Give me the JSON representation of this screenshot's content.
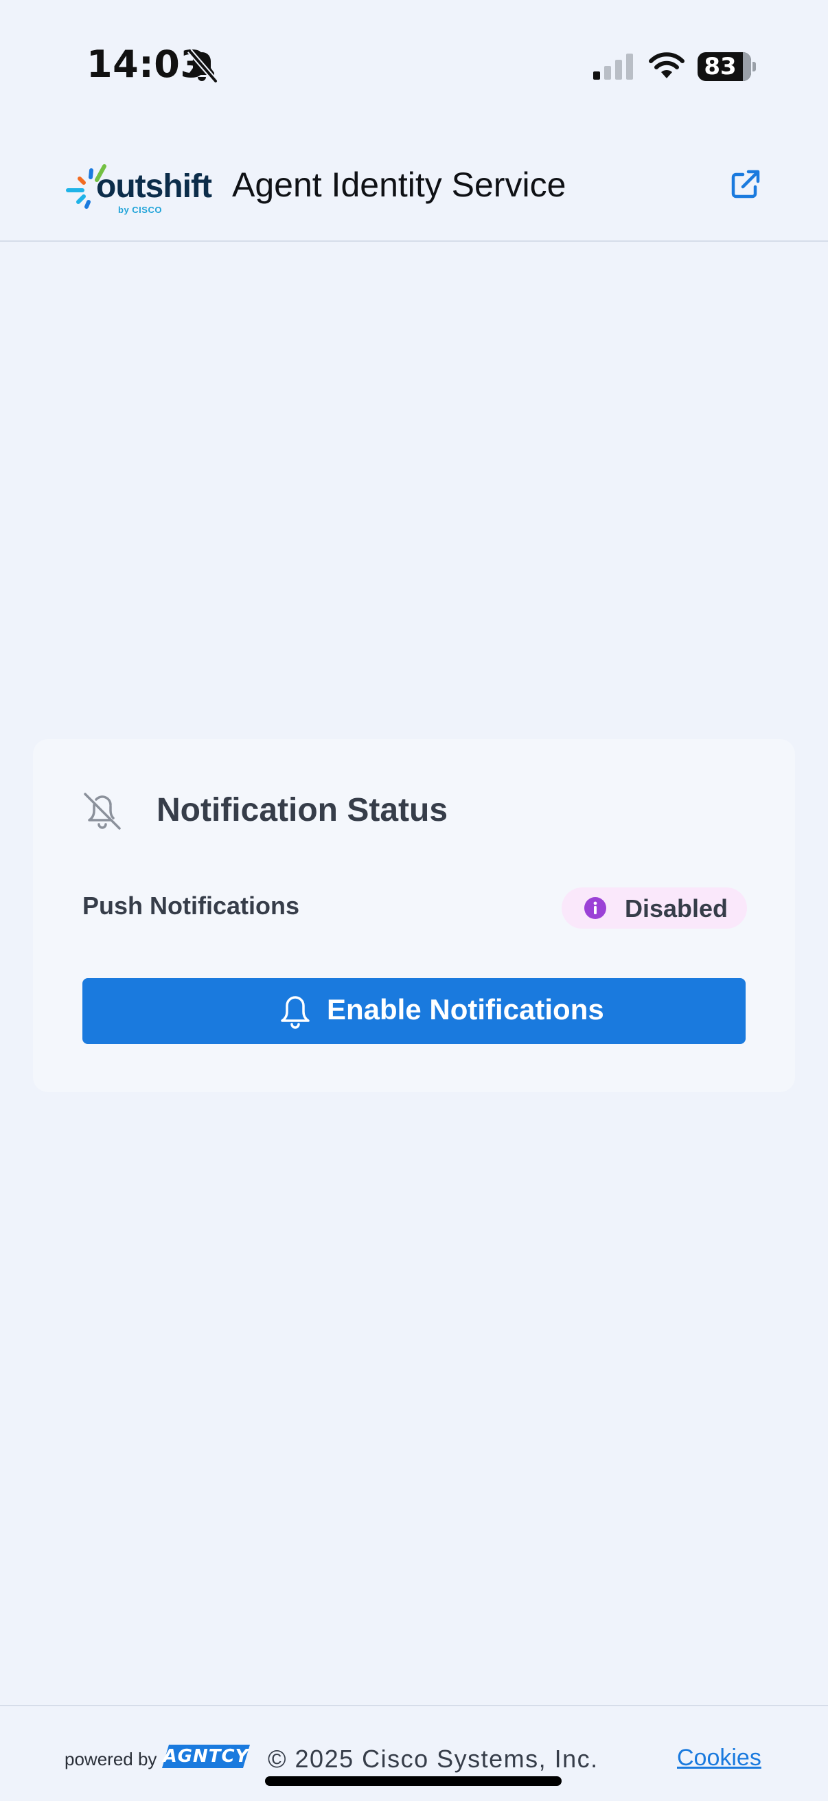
{
  "status_bar": {
    "time": "14:03",
    "battery_level": "83",
    "icons": [
      "silent-mode-icon",
      "cellular-signal-icon",
      "wifi-icon",
      "battery-icon"
    ]
  },
  "header": {
    "logo_word": "outshift",
    "logo_sub": "by CISCO",
    "title": "Agent Identity Service",
    "external_link_icon": "external-link-icon"
  },
  "card": {
    "icon": "bell-off-icon",
    "title": "Notification Status",
    "push_label": "Push Notifications",
    "status_badge": {
      "icon": "info-icon",
      "text": "Disabled",
      "bg_color": "#fae8fb",
      "icon_color": "#9b41d6"
    },
    "enable_button": {
      "icon": "bell-icon",
      "label": "Enable Notifications",
      "color": "#1a7ade"
    }
  },
  "footer": {
    "powered_by": "powered by",
    "agntcy_logo_text": "AGNTCY",
    "copyright": "© 2025 Cisco Systems, Inc.",
    "cookies": "Cookies"
  },
  "colors": {
    "background": "#eff3fb",
    "card": "#f4f7fc",
    "accent": "#1a7ade",
    "text": "#363d49"
  }
}
